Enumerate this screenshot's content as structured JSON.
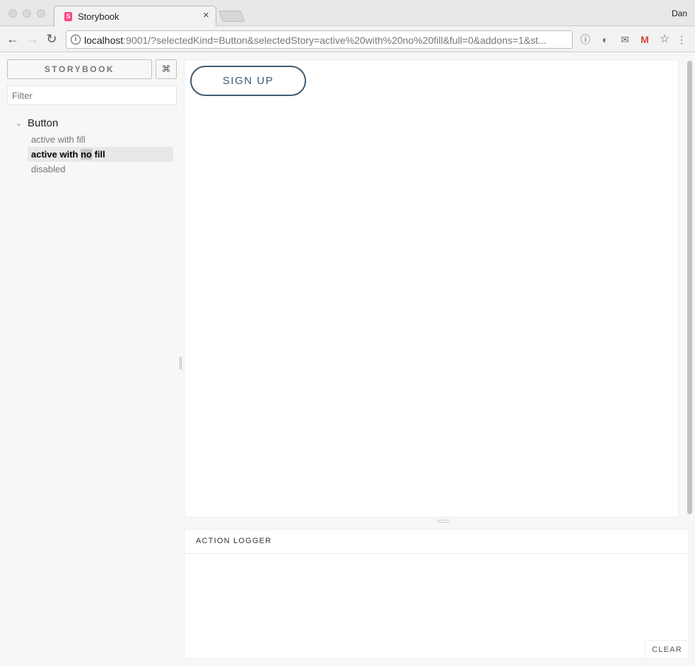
{
  "browser": {
    "tab_title": "Storybook",
    "favicon_letter": "S",
    "tab_close": "×",
    "profile_name": "Dan",
    "url_host": "localhost",
    "url_rest": ":9001/?selectedKind=Button&selectedStory=active%20with%20no%20fill&full=0&addons=1&st...",
    "nav": {
      "back": "←",
      "forward": "→",
      "reload": "↻"
    },
    "info_icon": "i",
    "extensions": [
      "ⓘ",
      "◐",
      "✉",
      "M",
      "☆",
      "⋮"
    ]
  },
  "sidebar": {
    "brand": "STORYBOOK",
    "shortcuts_label": "⌘",
    "filter_placeholder": "Filter",
    "kind": {
      "label": "Button",
      "chevron": "⌄"
    },
    "stories": [
      {
        "label": "active with fill",
        "selected": false
      },
      {
        "label_before": "active with ",
        "label_highlight": "no",
        "label_after": " fill",
        "selected": true
      },
      {
        "label": "disabled",
        "selected": false
      }
    ]
  },
  "preview": {
    "button_label": "SIGN UP"
  },
  "addon_panel": {
    "tab_label": "ACTION LOGGER",
    "clear_label": "CLEAR"
  },
  "colors": {
    "button_border": "#3f5a70",
    "favicon": "#ff4785",
    "selected_bg": "#e8e8e8"
  }
}
